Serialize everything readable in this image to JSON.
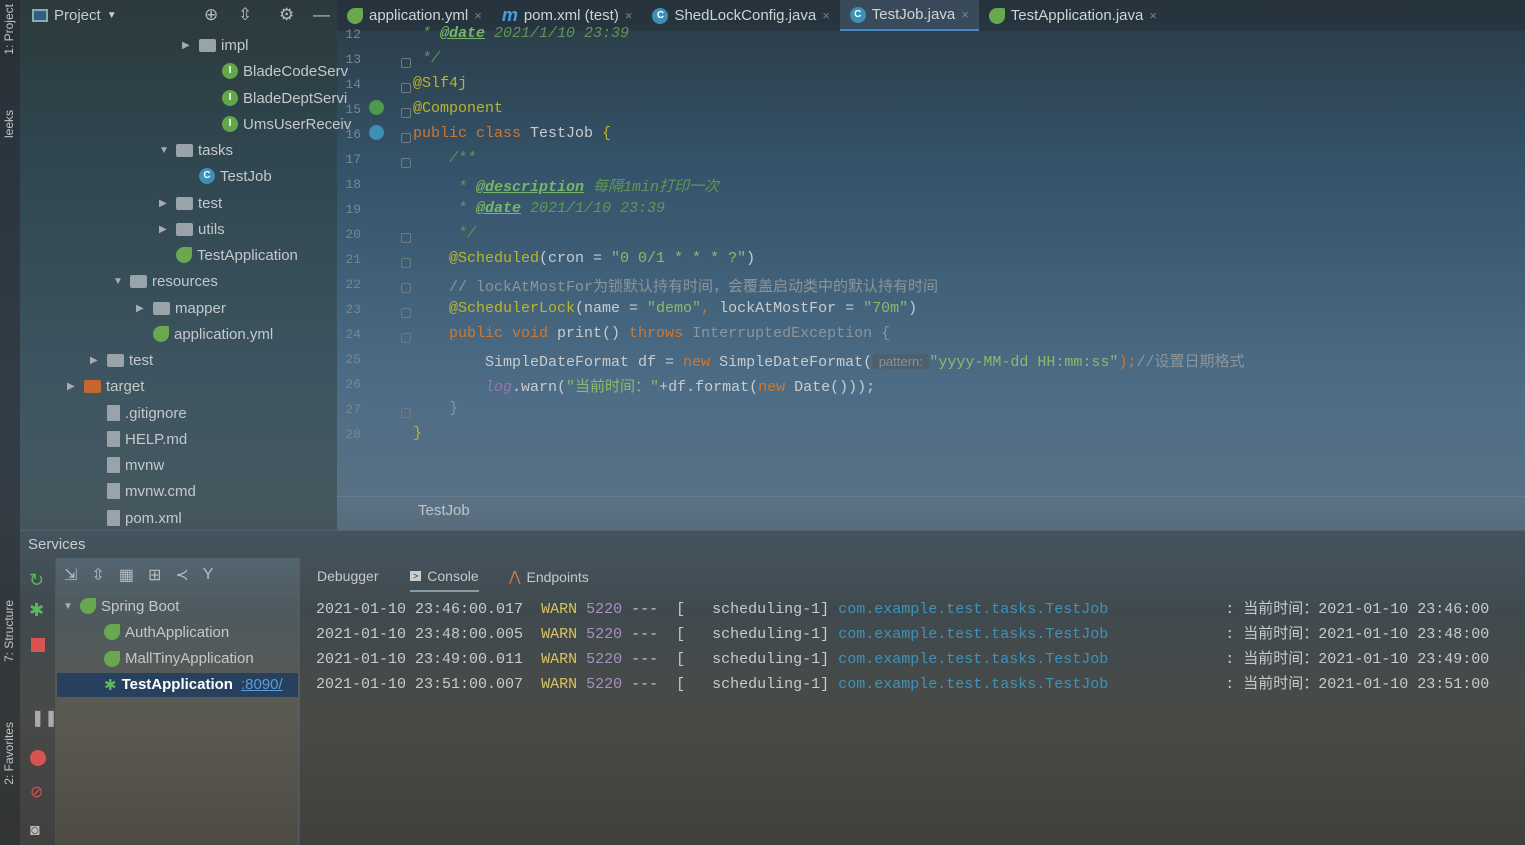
{
  "left_strip": {
    "project": "1: Project",
    "leeks": "leeks",
    "structure": "7: Structure",
    "favorites": "2: Favorites"
  },
  "project_panel": {
    "title": "Project",
    "items": [
      {
        "label": "impl",
        "type": "folder",
        "indent": 0,
        "arrow": "▶"
      },
      {
        "label": "BladeCodeServ",
        "type": "i",
        "indent": 1,
        "arrow": ""
      },
      {
        "label": "BladeDeptServi",
        "type": "i",
        "indent": 1,
        "arrow": ""
      },
      {
        "label": "UmsUserReceiv",
        "type": "i",
        "indent": 1,
        "arrow": ""
      },
      {
        "label": "tasks",
        "type": "folder",
        "indent": -1,
        "arrow": "▼"
      },
      {
        "label": "TestJob",
        "type": "c",
        "indent": 0,
        "arrow": ""
      },
      {
        "label": "test",
        "type": "folder",
        "indent": -1,
        "arrow": "▶"
      },
      {
        "label": "utils",
        "type": "folder",
        "indent": -1,
        "arrow": "▶"
      },
      {
        "label": "TestApplication",
        "type": "sb",
        "indent": -1,
        "arrow": ""
      },
      {
        "label": "resources",
        "type": "folder",
        "indent": -3,
        "arrow": "▼"
      },
      {
        "label": "mapper",
        "type": "folder",
        "indent": -2,
        "arrow": "▶"
      },
      {
        "label": "application.yml",
        "type": "sb",
        "indent": -2,
        "arrow": ""
      },
      {
        "label": "test",
        "type": "folder",
        "indent": -4,
        "arrow": "▶"
      },
      {
        "label": "target",
        "type": "folder-o",
        "indent": -5,
        "arrow": "▶"
      },
      {
        "label": ".gitignore",
        "type": "file",
        "indent": -4,
        "arrow": ""
      },
      {
        "label": "HELP.md",
        "type": "file",
        "indent": -4,
        "arrow": ""
      },
      {
        "label": "mvnw",
        "type": "file",
        "indent": -4,
        "arrow": ""
      },
      {
        "label": "mvnw.cmd",
        "type": "file",
        "indent": -4,
        "arrow": ""
      },
      {
        "label": "pom.xml",
        "type": "file",
        "indent": -4,
        "arrow": ""
      }
    ]
  },
  "tabs": [
    {
      "label": "application.yml",
      "icon": "spring",
      "active": false
    },
    {
      "label": "pom.xml (test)",
      "icon": "maven",
      "active": false
    },
    {
      "label": "ShedLockConfig.java",
      "icon": "class",
      "active": false
    },
    {
      "label": "TestJob.java",
      "icon": "class",
      "active": true
    },
    {
      "label": "TestApplication.java",
      "icon": "spring",
      "active": false
    }
  ],
  "editor": {
    "lines": [
      {
        "n": "12",
        "t": [
          [
            " * ",
            "dc"
          ],
          [
            "@date",
            "dt"
          ],
          [
            " 2021/1/10 23:39",
            "dc"
          ]
        ]
      },
      {
        "n": "13",
        "t": [
          [
            " */",
            "dc"
          ]
        ]
      },
      {
        "n": "14",
        "t": [
          [
            "@Slf4j",
            "an"
          ]
        ]
      },
      {
        "n": "15",
        "t": [
          [
            "@Component",
            "an"
          ]
        ]
      },
      {
        "n": "16",
        "t": [
          [
            "public class ",
            "k"
          ],
          [
            "TestJob ",
            ""
          ],
          [
            "{",
            "an"
          ]
        ]
      },
      {
        "n": "17",
        "t": [
          [
            "    /**",
            "dc"
          ]
        ]
      },
      {
        "n": "18",
        "t": [
          [
            "     * ",
            "dc"
          ],
          [
            "@description",
            "dt"
          ],
          [
            " 每隔1min打印一次",
            "dc"
          ]
        ]
      },
      {
        "n": "19",
        "t": [
          [
            "     * ",
            "dc"
          ],
          [
            "@date",
            "dt"
          ],
          [
            " 2021/1/10 23:39",
            "dc"
          ]
        ]
      },
      {
        "n": "20",
        "t": [
          [
            "     */",
            "dc"
          ]
        ]
      },
      {
        "n": "21",
        "t": [
          [
            "    @Scheduled",
            "an"
          ],
          [
            "(cron = ",
            ""
          ],
          [
            "\"0 0/1 * * * ?\"",
            "s"
          ],
          [
            ")",
            ""
          ]
        ]
      },
      {
        "n": "22",
        "t": [
          [
            "    // lockAtMostFor为锁默认持有时间，会覆盖启动类中的默认持有时间",
            "cm"
          ]
        ]
      },
      {
        "n": "23",
        "t": [
          [
            "    @SchedulerLock",
            "an"
          ],
          [
            "(name = ",
            ""
          ],
          [
            "\"demo\"",
            "s"
          ],
          [
            ", ",
            "k"
          ],
          [
            "lockAtMostFor = ",
            ""
          ],
          [
            "\"70m\"",
            "s"
          ],
          [
            ")",
            ""
          ]
        ]
      },
      {
        "n": "24",
        "t": [
          [
            "    public void ",
            "k"
          ],
          [
            "print() ",
            ""
          ],
          [
            "throws ",
            "k"
          ],
          [
            "InterruptedException {",
            "cm"
          ]
        ]
      },
      {
        "n": "25",
        "t": [
          [
            "        SimpleDateFormat df = ",
            ""
          ],
          [
            "new ",
            "k"
          ],
          [
            "SimpleDateFormat(",
            ""
          ],
          [
            " pattern: ",
            "hint"
          ],
          [
            "\"yyyy-MM-dd HH:mm:ss\"",
            "s"
          ],
          [
            ");",
            "k"
          ],
          [
            "//设置日期格式",
            "cm"
          ]
        ]
      },
      {
        "n": "26",
        "t": [
          [
            "        ",
            ""
          ],
          [
            "log",
            "f"
          ],
          [
            ".warn(",
            ""
          ],
          [
            "\"当前时间：\"",
            "s"
          ],
          [
            "+df.format(",
            ""
          ],
          [
            "new ",
            "k"
          ],
          [
            "Date()));",
            ""
          ]
        ]
      },
      {
        "n": "27",
        "t": [
          [
            "    }",
            "cm"
          ]
        ]
      },
      {
        "n": "28",
        "t": [
          [
            "}",
            "an"
          ]
        ]
      }
    ],
    "breadcrumb": "TestJob"
  },
  "services": {
    "title": "Services",
    "tree": [
      {
        "label": "Spring Boot",
        "arrow": "▼",
        "level": 0,
        "selected": false,
        "port": ""
      },
      {
        "label": "AuthApplication",
        "arrow": "",
        "level": 1,
        "selected": false,
        "port": ""
      },
      {
        "label": "MallTinyApplication",
        "arrow": "",
        "level": 1,
        "selected": false,
        "port": ""
      },
      {
        "label": "TestApplication",
        "arrow": "",
        "level": 1,
        "selected": true,
        "port": ":8090/"
      }
    ],
    "console_tabs": [
      "Debugger",
      "Console",
      "Endpoints"
    ],
    "logs": [
      {
        "ts": "2021-01-10 23:46:00.017",
        "level": "WARN",
        "pid": "5220",
        "thread": "---  [   scheduling-1]",
        "cls": "com.example.test.tasks.TestJob",
        "msg": "  : 当前时间：2021-01-10 23:46:00"
      },
      {
        "ts": "2021-01-10 23:48:00.005",
        "level": "WARN",
        "pid": "5220",
        "thread": "---  [   scheduling-1]",
        "cls": "com.example.test.tasks.TestJob",
        "msg": "  : 当前时间：2021-01-10 23:48:00"
      },
      {
        "ts": "2021-01-10 23:49:00.011",
        "level": "WARN",
        "pid": "5220",
        "thread": "---  [   scheduling-1]",
        "cls": "com.example.test.tasks.TestJob",
        "msg": "  : 当前时间：2021-01-10 23:49:00"
      },
      {
        "ts": "2021-01-10 23:51:00.007",
        "level": "WARN",
        "pid": "5220",
        "thread": "---  [   scheduling-1]",
        "cls": "com.example.test.tasks.TestJob",
        "msg": "  : 当前时间：2021-01-10 23:51:00"
      }
    ]
  }
}
